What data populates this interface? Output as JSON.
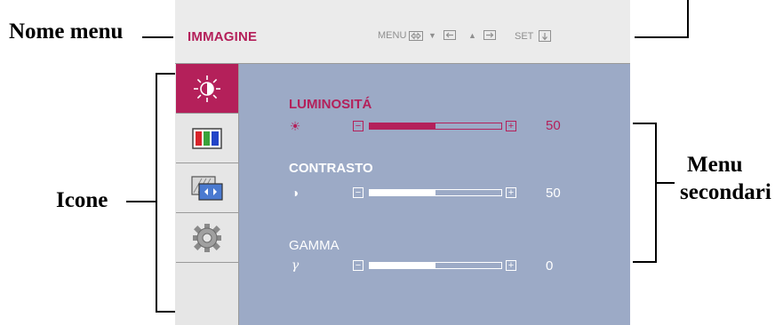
{
  "callouts": {
    "menu_name": "Nome menu",
    "icons": "Icone",
    "submenu_line1": "Menu",
    "submenu_line2": "secondari"
  },
  "osd": {
    "menu_title": "IMMAGINE",
    "nav_keys": [
      {
        "label": "MENU",
        "icon": "exit-key-icon"
      },
      {
        "label": "▼",
        "icon": "left-arrow-key-icon"
      },
      {
        "label": "▲",
        "icon": "right-arrow-key-icon"
      },
      {
        "label": "SET",
        "icon": "enter-key-icon"
      }
    ],
    "sidebar_icons": [
      "brightness-icon",
      "color-bars-icon",
      "screen-position-icon",
      "gear-icon"
    ],
    "items": [
      {
        "label": "LUMINOSITÁ",
        "symbol": "☀",
        "value": "50",
        "level": 0.5,
        "active": true
      },
      {
        "label": "CONTRASTO",
        "symbol": "◑",
        "value": "50",
        "level": 0.5,
        "active": false
      },
      {
        "label": "GAMMA",
        "symbol": "γ",
        "value": "0",
        "level": 0.5,
        "active": false
      }
    ]
  },
  "colors": {
    "accent": "#b4205a",
    "panel": "#9caac6",
    "header": "#ebebeb",
    "sidebar": "#e6e6e6"
  }
}
